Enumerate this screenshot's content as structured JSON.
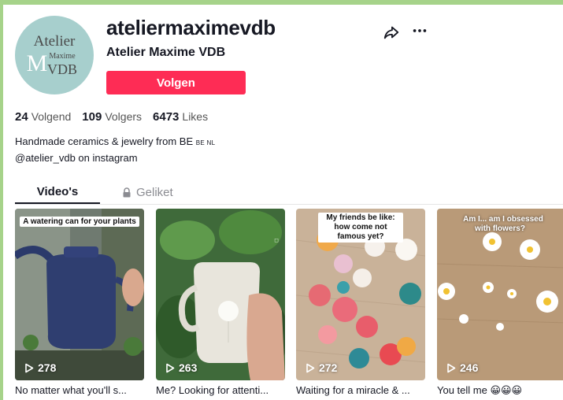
{
  "profile": {
    "avatar_text_line1": "Atelier",
    "avatar_text_line2": "Maxime",
    "avatar_text_line3": "VDB",
    "avatar_text_letter": "M",
    "username": "ateliermaximevdb",
    "nickname": "Atelier Maxime VDB",
    "follow_label": "Volgen",
    "share_icon": "share-icon",
    "more_icon": "more-icon"
  },
  "stats": {
    "following_count": "24",
    "following_label": "Volgend",
    "followers_count": "109",
    "followers_label": "Volgers",
    "likes_count": "6473",
    "likes_label": "Likes"
  },
  "bio": {
    "line1": "Handmade ceramics & jewelry from BE",
    "line1_flags": "BE NL",
    "line2": "@atelier_vdb on instagram"
  },
  "tabs": {
    "videos_label": "Video's",
    "liked_label": "Geliket",
    "liked_icon": "lock-icon"
  },
  "videos": [
    {
      "overlay": "A watering can for your plants",
      "views": "278",
      "caption": "No matter what you'll s..."
    },
    {
      "overlay": "",
      "views": "263",
      "caption": "Me? Looking for attenti..."
    },
    {
      "overlay": "My friends be like: how come not famous yet?",
      "views": "272",
      "caption": "Waiting for a miracle & ..."
    },
    {
      "overlay": "Am I... am I obsessed with flowers?",
      "views": "246",
      "caption": "You tell me 😀😀😀"
    }
  ],
  "colors": {
    "accent": "#fe2c55",
    "border_frame": "#a6d38a",
    "avatar_bg": "#a7cfcd"
  }
}
